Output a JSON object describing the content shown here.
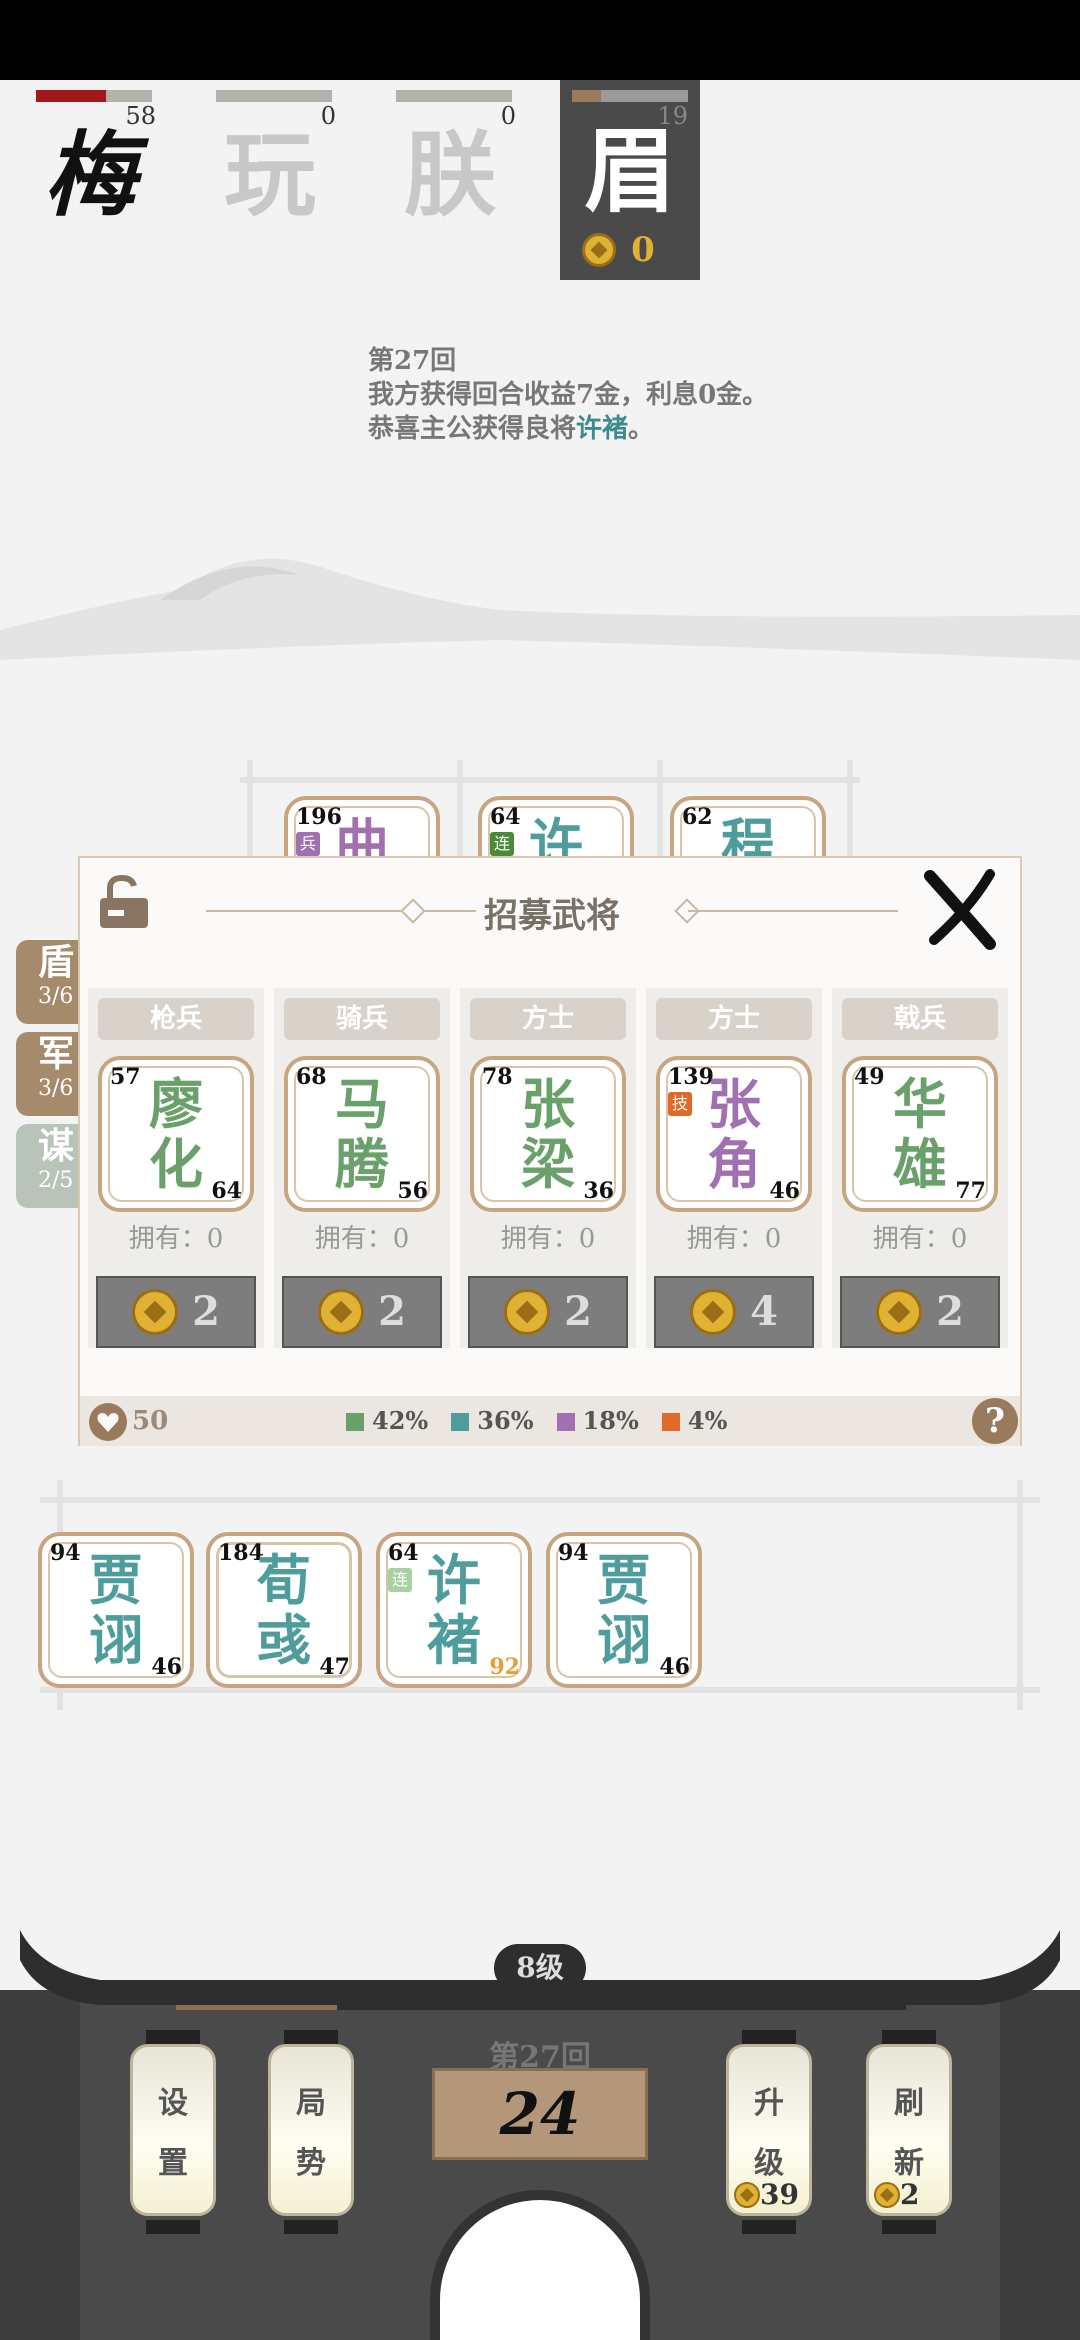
{
  "players": [
    {
      "name": "梅",
      "hp": "58",
      "hp_fraction": 0.6
    },
    {
      "name": "玩",
      "hp": "0",
      "hp_fraction": 0
    },
    {
      "name": "朕",
      "hp": "0",
      "hp_fraction": 0
    },
    {
      "name": "眉",
      "hp": "19",
      "hp_fraction": 0.25,
      "gold": "0"
    }
  ],
  "log": {
    "round": "第27回",
    "line1": "我方获得回合收益7金，利息0金。",
    "line2_prefix": "恭喜主公获得良将",
    "line2_hero": "许褚",
    "line2_suffix": "。"
  },
  "enemy_board": [
    {
      "atk": "196",
      "name": "曲",
      "tag": "兵"
    },
    {
      "atk": "64",
      "name": "许",
      "tag": "连"
    },
    {
      "atk": "62",
      "name": "程",
      "tag": ""
    }
  ],
  "side_tabs": [
    {
      "name": "盾",
      "count": "3/6"
    },
    {
      "name": "军",
      "count": "3/6"
    },
    {
      "name": "谋",
      "count": "2/5"
    }
  ],
  "recruit": {
    "title": "招募武将",
    "owned_label": "拥有：",
    "slots": [
      {
        "type": "枪兵",
        "name1": "廖",
        "name2": "化",
        "atk": "57",
        "hp": "64",
        "owned": "0",
        "price": "2",
        "tag": "",
        "color": "#6aa06a"
      },
      {
        "type": "骑兵",
        "name1": "马",
        "name2": "腾",
        "atk": "68",
        "hp": "56",
        "owned": "0",
        "price": "2",
        "tag": "",
        "color": "#6aa06a"
      },
      {
        "type": "方士",
        "name1": "张",
        "name2": "梁",
        "atk": "78",
        "hp": "36",
        "owned": "0",
        "price": "2",
        "tag": "",
        "color": "#6aa06a"
      },
      {
        "type": "方士",
        "name1": "张",
        "name2": "角",
        "atk": "139",
        "hp": "46",
        "owned": "0",
        "price": "4",
        "tag": "技",
        "color": "#a070b0"
      },
      {
        "type": "戟兵",
        "name1": "华",
        "name2": "雄",
        "atk": "49",
        "hp": "77",
        "owned": "0",
        "price": "2",
        "tag": "",
        "color": "#6aa06a"
      }
    ],
    "hearts": "50",
    "odds": [
      {
        "pct": "42%",
        "color": "#6aa06a"
      },
      {
        "pct": "36%",
        "color": "#4f9c9c"
      },
      {
        "pct": "18%",
        "color": "#a070b0"
      },
      {
        "pct": "4%",
        "color": "#e06a2a"
      }
    ],
    "help": "?"
  },
  "bench": [
    {
      "atk": "94",
      "name1": "贾",
      "name2": "诩",
      "hp": "46",
      "color": "#4f9c9c",
      "tag": "",
      "hp_orange": false
    },
    {
      "atk": "184",
      "name1": "荀",
      "name2": "彧",
      "hp": "47",
      "color": "#4f9c9c",
      "tag": "",
      "hp_orange": false
    },
    {
      "atk": "64",
      "name1": "许",
      "name2": "褚",
      "hp": "92",
      "color": "#4f9c9c",
      "tag": "连",
      "hp_orange": true
    },
    {
      "atk": "94",
      "name1": "贾",
      "name2": "诩",
      "hp": "46",
      "color": "#4f9c9c",
      "tag": "",
      "hp_orange": false
    }
  ],
  "bottom": {
    "level": "8级",
    "round": "第27回",
    "timer": "24",
    "settings": [
      "设",
      "置"
    ],
    "situation": [
      "局",
      "势"
    ],
    "upgrade": [
      "升",
      "级"
    ],
    "upgrade_cost": "39",
    "refresh": [
      "刷",
      "新"
    ],
    "refresh_cost": "2"
  }
}
